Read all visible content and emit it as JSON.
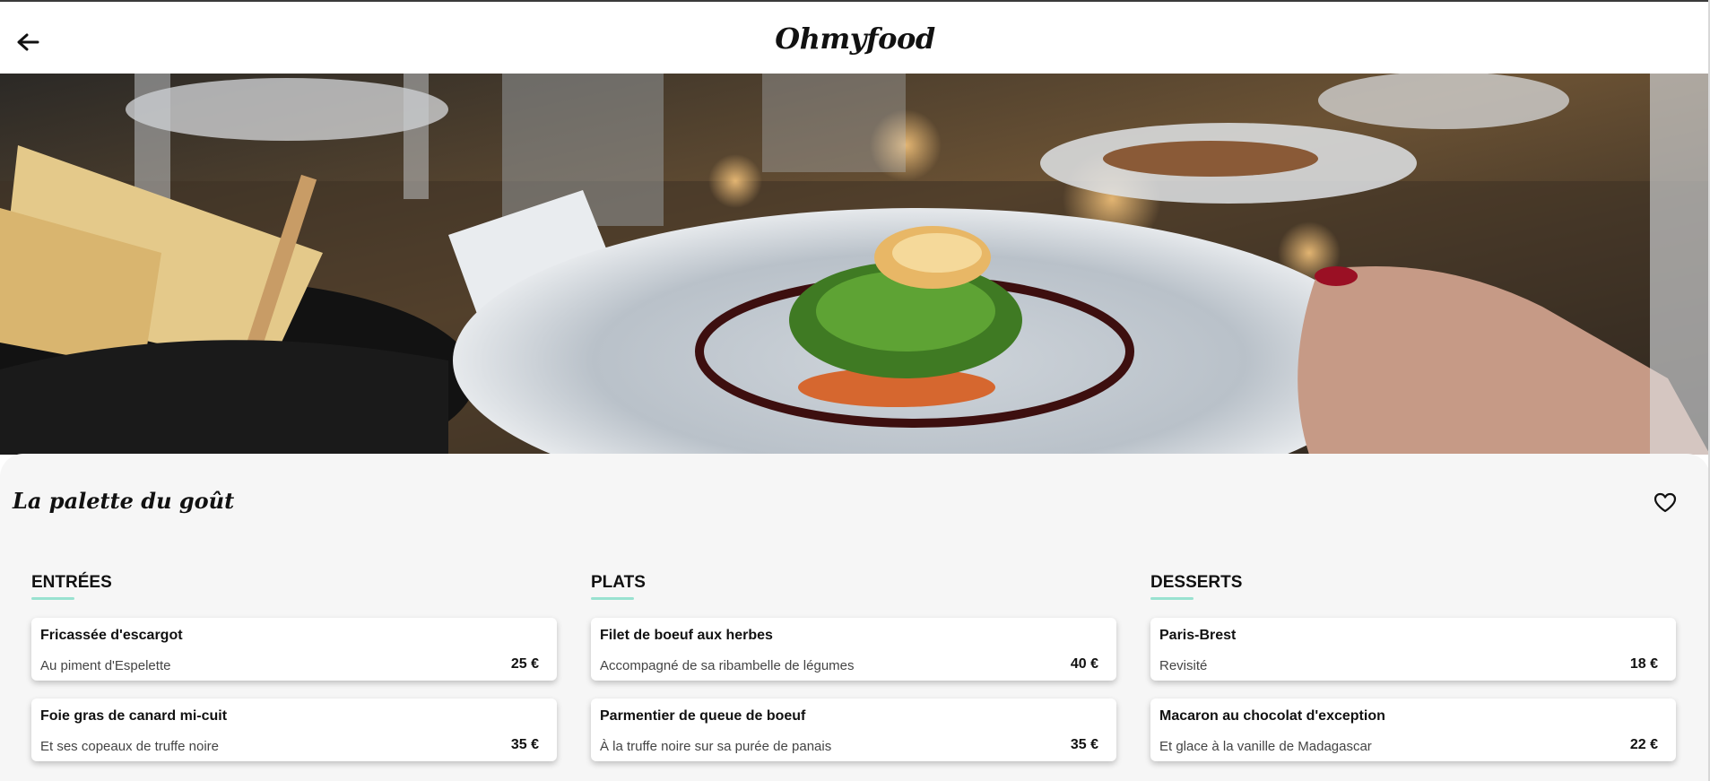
{
  "header": {
    "back_icon": "arrow-left-icon",
    "logo": "Ohmyfood"
  },
  "hero": {
    "image_subject": "restaurant-dish-photo"
  },
  "restaurant": {
    "name": "La palette du goût",
    "favorite_icon": "heart-outline-icon"
  },
  "menu": {
    "entrees": {
      "title": "ENTRÉES",
      "items": [
        {
          "name": "Fricassée d'escargot",
          "description": "Au piment d'Espelette",
          "price": "25 €"
        },
        {
          "name": "Foie gras de canard mi-cuit",
          "description": "Et ses copeaux de truffe noire",
          "price": "35 €"
        }
      ]
    },
    "plats": {
      "title": "PLATS",
      "items": [
        {
          "name": "Filet de boeuf aux herbes",
          "description": "Accompagné de sa ribambelle de légumes",
          "price": "40 €"
        },
        {
          "name": "Parmentier de queue de boeuf",
          "description": "À la truffe noire sur sa purée de panais",
          "price": "35 €"
        }
      ]
    },
    "desserts": {
      "title": "DESSERTS",
      "items": [
        {
          "name": "Paris-Brest",
          "description": "Revisité",
          "price": "18 €"
        },
        {
          "name": "Macaron au chocolat d'exception",
          "description": "Et glace à la vanille de Madagascar",
          "price": "22 €"
        }
      ]
    }
  },
  "colors": {
    "accent_underline": "#99e2d0",
    "panel_background": "#f6f6f6"
  }
}
